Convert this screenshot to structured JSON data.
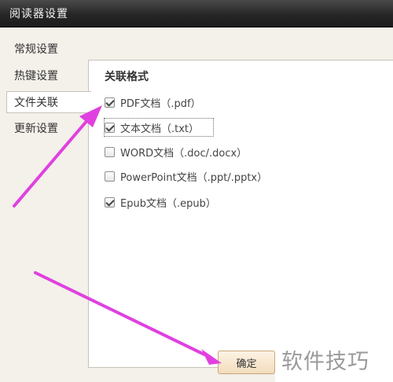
{
  "window": {
    "title": "阅读器设置"
  },
  "nav": {
    "items": [
      {
        "label": "常规设置"
      },
      {
        "label": "热键设置"
      },
      {
        "label": "文件关联"
      },
      {
        "label": "更新设置"
      }
    ],
    "active_index": 2
  },
  "panel": {
    "heading": "关联格式",
    "options": [
      {
        "label": "PDF文档（.pdf）",
        "checked": true
      },
      {
        "label": "文本文档（.txt）",
        "checked": true
      },
      {
        "label": "WORD文档（.doc/.docx）",
        "checked": false
      },
      {
        "label": "PowerPoint文档（.ppt/.pptx）",
        "checked": false
      },
      {
        "label": "Epub文档（.epub）",
        "checked": true
      }
    ]
  },
  "buttons": {
    "ok_label": "确定"
  },
  "watermark": {
    "text": "软件技巧"
  },
  "colors": {
    "annotation_arrow": "#e040e0",
    "title_bar": "#2a2a2a",
    "button_border": "#c9a87a"
  }
}
